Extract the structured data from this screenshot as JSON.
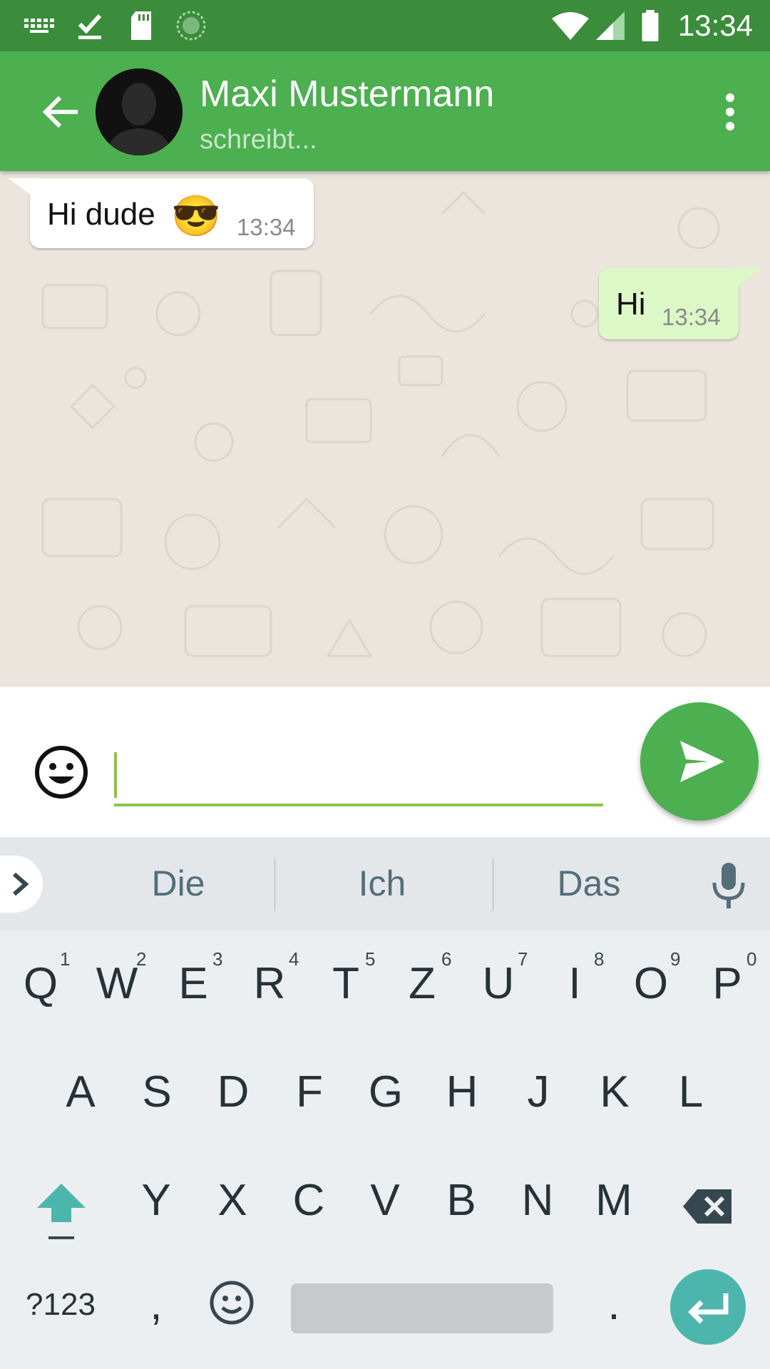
{
  "status_bar": {
    "time": "13:34",
    "left_icons": [
      "keyboard-icon",
      "download-done-icon",
      "sd-card-icon",
      "sync-icon"
    ],
    "right_icons": [
      "wifi-icon",
      "signal-icon",
      "battery-icon"
    ]
  },
  "header": {
    "contact_name": "Maxi Mustermann",
    "contact_status": "schreibt...",
    "color": "#4caf50"
  },
  "messages": [
    {
      "direction": "incoming",
      "text": "Hi dude",
      "emoji": "😎",
      "time": "13:34"
    },
    {
      "direction": "outgoing",
      "text": "Hi",
      "time": "13:34"
    }
  ],
  "composer": {
    "value": "",
    "placeholder": ""
  },
  "keyboard": {
    "suggestions": [
      "Die",
      "Ich",
      "Das"
    ],
    "row1": [
      {
        "key": "Q",
        "hint": "1"
      },
      {
        "key": "W",
        "hint": "2"
      },
      {
        "key": "E",
        "hint": "3"
      },
      {
        "key": "R",
        "hint": "4"
      },
      {
        "key": "T",
        "hint": "5"
      },
      {
        "key": "Z",
        "hint": "6"
      },
      {
        "key": "U",
        "hint": "7"
      },
      {
        "key": "I",
        "hint": "8"
      },
      {
        "key": "O",
        "hint": "9"
      },
      {
        "key": "P",
        "hint": "0"
      }
    ],
    "row2": [
      "A",
      "S",
      "D",
      "F",
      "G",
      "H",
      "J",
      "K",
      "L"
    ],
    "row3": [
      "Y",
      "X",
      "C",
      "V",
      "B",
      "N",
      "M"
    ],
    "symbols_label": "?123",
    "comma_label": ",",
    "period_label": ".",
    "accent_color": "#4db6ac"
  }
}
